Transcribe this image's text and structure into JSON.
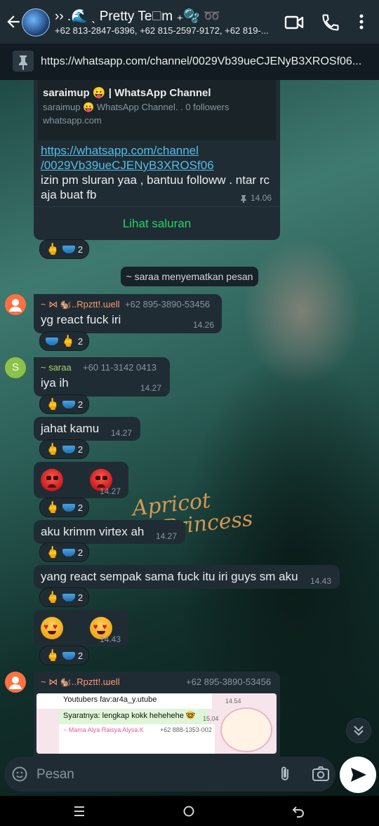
{
  "header": {
    "title": "›› .🌊 ˎ Pretty Te🗆m ₊🫧 ➿",
    "members": "+62 813-2847-6396, +62 815-2597-9172, +62 819-...",
    "icons": [
      "back-arrow-icon",
      "video-call-icon",
      "voice-call-icon",
      "more-options-icon"
    ]
  },
  "pinned": {
    "text": "https://whatsapp.com/channel/0029Vb39ueCJENyB3XROSf06..."
  },
  "channel_card": {
    "title": "saraimup 😛 | WhatsApp Channel",
    "description": "saraimup 😛 WhatsApp Channel. . 0 followers",
    "domain": "whatsapp.com",
    "link_line1": "https://whatsapp.com/channel",
    "link_line2": "/0029Vb39ueCJENyB3XROSf06",
    "message_line1": "izin pm sluran yaa , bantuu followw . ntar rc",
    "message_line2": "aja buat fb",
    "time": "14.06",
    "action": "Lihat saluran",
    "reaction_count": "2"
  },
  "system_note": "~ saraa menyematkan pesan",
  "messages": [
    {
      "sender": "~ ⋈ 🐿️..Rpztt!.ɯell",
      "phone": "+62 895-3890-53456",
      "text": "yg react fuck iri",
      "time": "14.26",
      "reaction_count": "2"
    },
    {
      "sender": "~ saraa",
      "phone": "+60 11-3142 0413",
      "text": "iya ih",
      "time": "14.27",
      "reaction_count": "2",
      "avatar_letter": "S"
    },
    {
      "text": "jahat kamu",
      "time": "14.27",
      "reaction_count": "2"
    },
    {
      "text": "😡😡",
      "time": "14.27",
      "reaction_count": "2"
    },
    {
      "text": "aku krimm virtex ah",
      "time": "14.27",
      "reaction_count": "2"
    },
    {
      "text": "yang react sempak sama fuck itu iri guys sm aku",
      "time": "14.43",
      "reaction_count": "2"
    },
    {
      "text": "😍😍",
      "time": "14.43",
      "reaction_count": "2"
    },
    {
      "sender": "~ ⋈ 🐿️..Rpztt!.ɯell",
      "phone": "+62 895-3890-53456"
    }
  ],
  "quoted_preview": {
    "line1": "Youtubers fav:ar4a_y.utube",
    "time1": "14.54",
    "line2": "Syaratnya: lengkap kokk hehehehe 🤓",
    "time2": "15.04",
    "sender3": "~ Mama Alya Raisya Alysa.K",
    "phone3": "+62 888-1353-002"
  },
  "wallpaper_text": {
    "line1": "Apricot",
    "line2": "Princess"
  },
  "composer": {
    "placeholder": "Pesan"
  },
  "colors": {
    "header_bg": "#1f2c34",
    "bubble_bg": "#202c33",
    "link": "#53bdeb",
    "accent_green": "#25d366",
    "sender_orange": "#fc9775",
    "sender_green": "#a5d563"
  }
}
